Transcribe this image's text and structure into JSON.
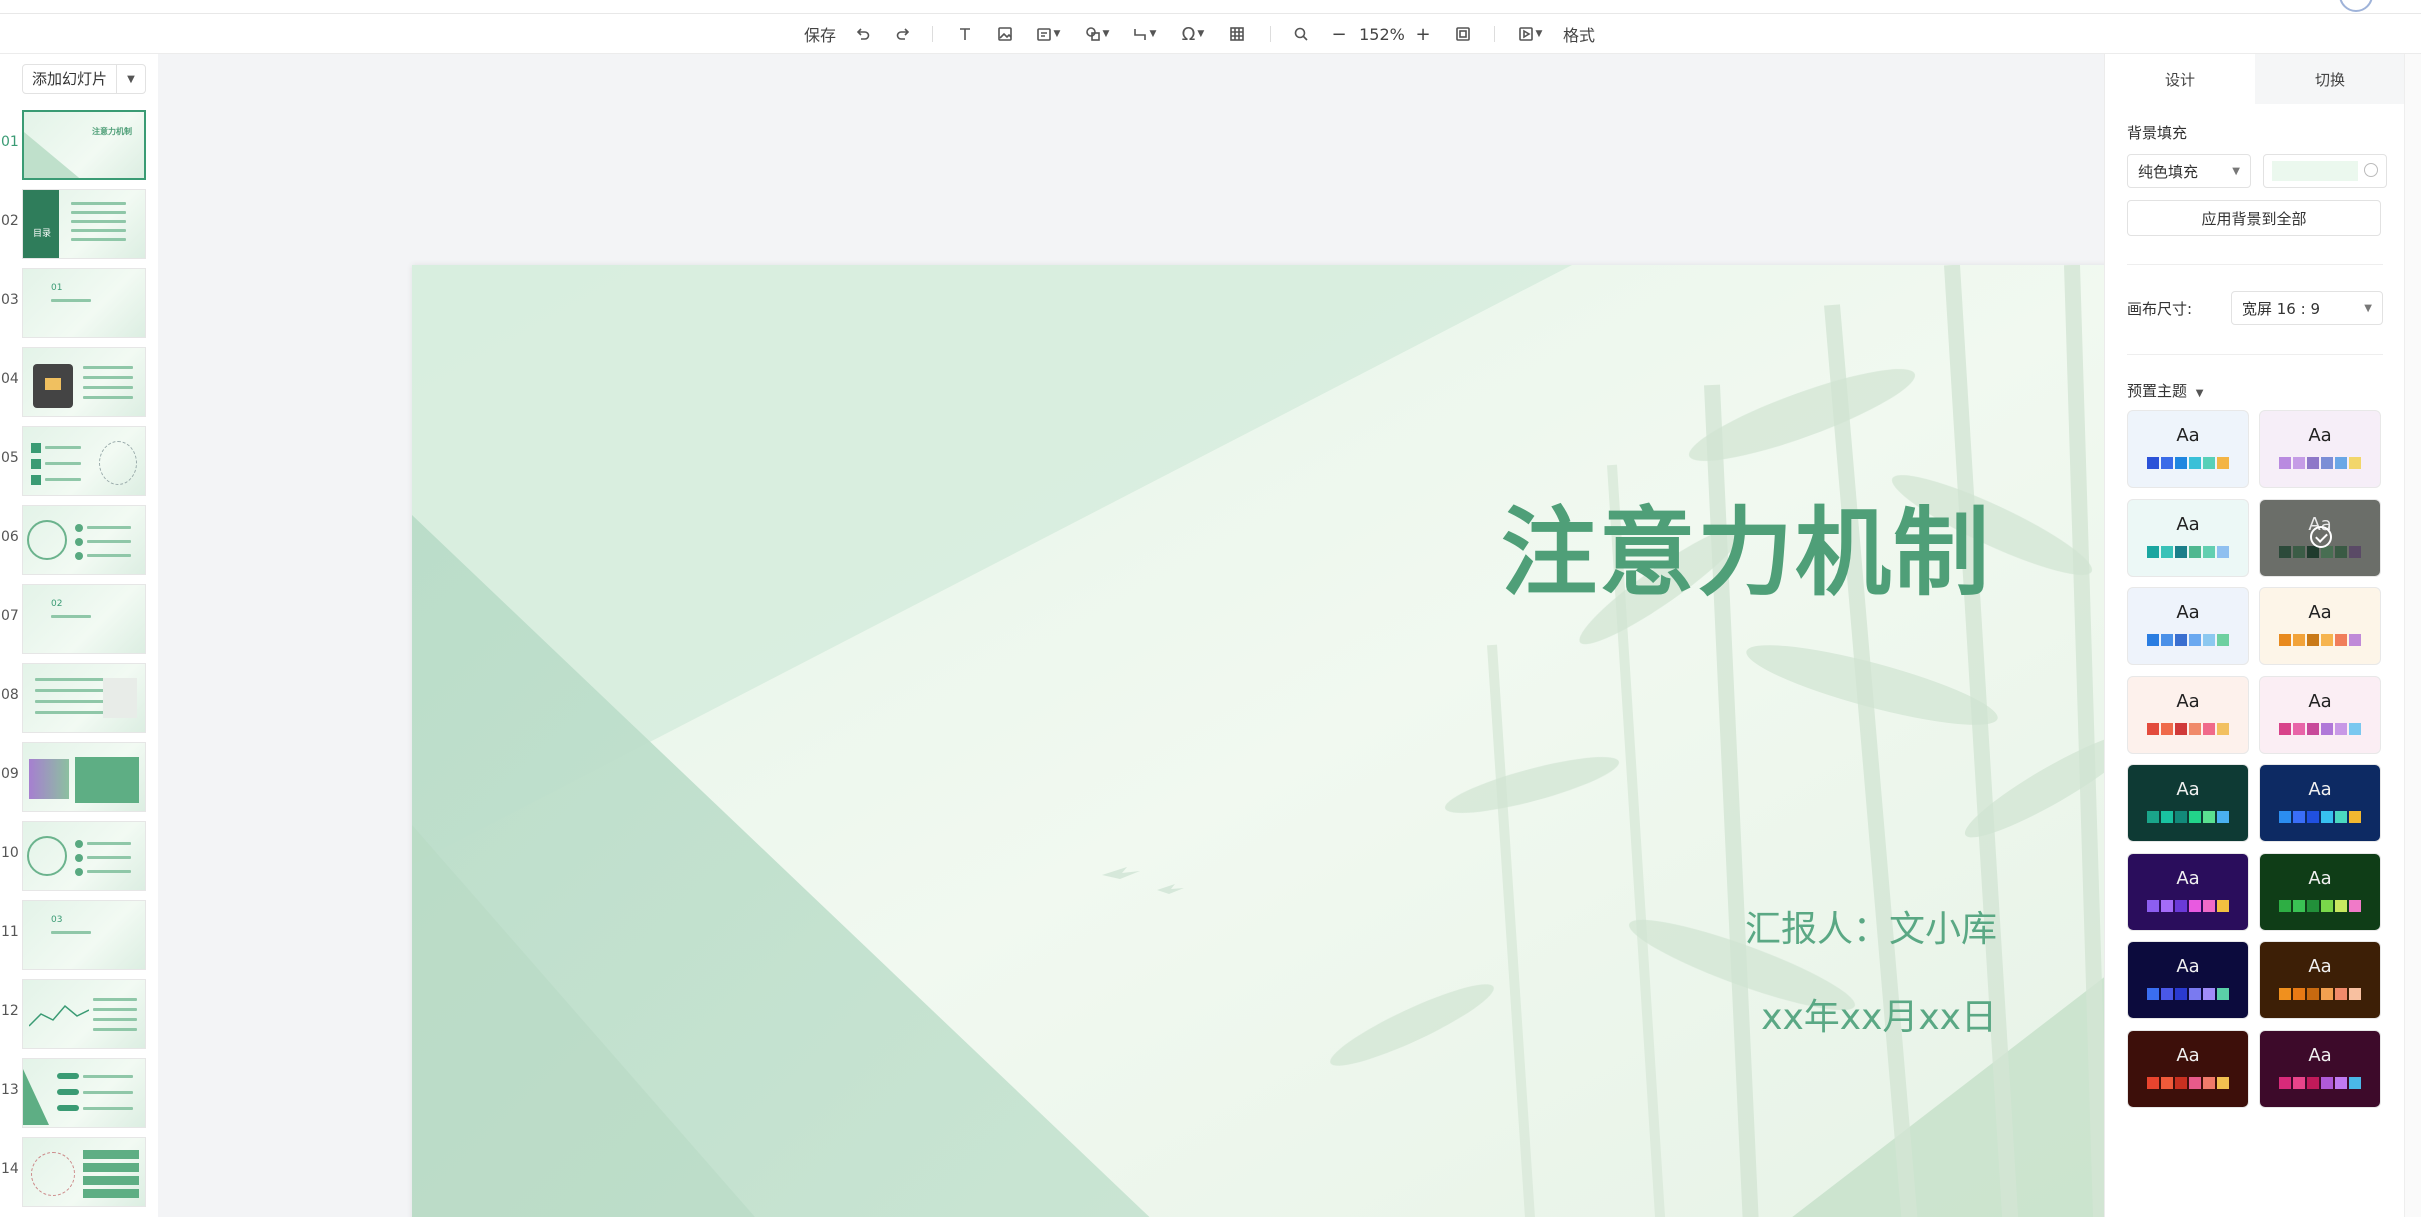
{
  "toolbar": {
    "save_label": "保存",
    "zoom": "152%",
    "format_label": "格式"
  },
  "sidebar": {
    "add_slide_label": "添加幻灯片",
    "slides": [
      "01",
      "02",
      "03",
      "04",
      "05",
      "06",
      "07",
      "08",
      "09",
      "10",
      "11",
      "12",
      "13",
      "14"
    ],
    "active_index": 0,
    "slide_texts": {
      "s01_title": "注意力机制",
      "s02_label": "目录",
      "s03_num": "01",
      "s07_num": "02",
      "s11_num": "03"
    }
  },
  "slide": {
    "title": "注意力机制",
    "reporter": "汇报人：文小库",
    "date": "xx年xx月xx日"
  },
  "panel": {
    "tabs": [
      "设计",
      "切换"
    ],
    "active_tab": 0,
    "bg_fill_label": "背景填充",
    "fill_type": "纯色填充",
    "fill_color": "#ebf8ee",
    "apply_all_label": "应用背景到全部",
    "canvas_size_label": "画布尺寸:",
    "canvas_size_value": "宽屏 16 : 9",
    "preset_theme_label": "预置主题",
    "theme_sample": "Aa",
    "themes": [
      {
        "bg": "#eef4fb",
        "text": "#222",
        "colors": [
          "#2b52d8",
          "#3a6be8",
          "#1f86e0",
          "#39c0d8",
          "#58d0b8",
          "#f3b445"
        ]
      },
      {
        "bg": "#f6eef8",
        "text": "#222",
        "colors": [
          "#b98ae0",
          "#c59ce6",
          "#8e78c8",
          "#7b8ed6",
          "#6aa7e6",
          "#f2d66a"
        ]
      },
      {
        "bg": "#ecf8f6",
        "text": "#222",
        "colors": [
          "#1aa6a0",
          "#38c2b8",
          "#1b7f8a",
          "#4fb890",
          "#62cfb0",
          "#8fc0f0"
        ]
      },
      {
        "bg": "#6b6e69",
        "text": "#e8e8e8",
        "colors": [
          "#2c4a3a",
          "#3b5c46",
          "#1f3b2d",
          "#486e52",
          "#3a5a44",
          "#5a4a66"
        ],
        "selected": true
      },
      {
        "bg": "#eef3fb",
        "text": "#222",
        "colors": [
          "#2a7de1",
          "#4a90e8",
          "#3a6fd0",
          "#6aa8f0",
          "#8cc8f0",
          "#6ed0a0"
        ]
      },
      {
        "bg": "#fdf5e8",
        "text": "#222",
        "colors": [
          "#e88a1e",
          "#f2a33a",
          "#c97a18",
          "#f6b44e",
          "#f07e5a",
          "#c08ad8"
        ]
      },
      {
        "bg": "#fdf1ec",
        "text": "#222",
        "colors": [
          "#e34b3c",
          "#ef6a4a",
          "#d03a3a",
          "#f08a6a",
          "#f06a8a",
          "#f2c060"
        ]
      },
      {
        "bg": "#fbeef4",
        "text": "#222",
        "colors": [
          "#d8438a",
          "#e865a8",
          "#c84a9a",
          "#b078d8",
          "#c898e6",
          "#7ac8f0"
        ]
      },
      {
        "bg": "#0e3a34",
        "text": "#f0f0f0",
        "colors": [
          "#1aa58a",
          "#19c2a0",
          "#128a7a",
          "#22d48a",
          "#5ae090",
          "#4ab0f0"
        ]
      },
      {
        "bg": "#0d2a63",
        "text": "#f0f0f0",
        "colors": [
          "#2b8df0",
          "#3a6ef8",
          "#2050e0",
          "#37c0f0",
          "#4ad8c0",
          "#f2b830"
        ]
      },
      {
        "bg": "#2a0d5c",
        "text": "#f0f0f0",
        "colors": [
          "#8c5ef0",
          "#a46cf8",
          "#6a3ad8",
          "#e85ae0",
          "#f06ac8",
          "#f2c040"
        ]
      },
      {
        "bg": "#0f3d17",
        "text": "#f0f0f0",
        "colors": [
          "#2eae44",
          "#3ac254",
          "#22903a",
          "#7ad84a",
          "#c8e860",
          "#f07ac8"
        ]
      },
      {
        "bg": "#0c0b3d",
        "text": "#f0f0f0",
        "colors": [
          "#3a6ef0",
          "#4a58e8",
          "#2a3ad0",
          "#7a7af0",
          "#a08cf8",
          "#5ad0a8"
        ]
      },
      {
        "bg": "#3d1f06",
        "text": "#f0f0f0",
        "colors": [
          "#f0901e",
          "#e87a14",
          "#c86a10",
          "#f2a050",
          "#f08a6a",
          "#f8c0a0"
        ]
      },
      {
        "bg": "#3d0f0a",
        "text": "#f0f0f0",
        "colors": [
          "#e8442e",
          "#f05a3a",
          "#c83020",
          "#e85a8a",
          "#f07a6a",
          "#f2c050"
        ]
      },
      {
        "bg": "#3d0a2a",
        "text": "#f0f0f0",
        "colors": [
          "#d82a7a",
          "#e8448a",
          "#c01a5a",
          "#b05ad8",
          "#c07af0",
          "#4ab8e8"
        ]
      }
    ]
  }
}
